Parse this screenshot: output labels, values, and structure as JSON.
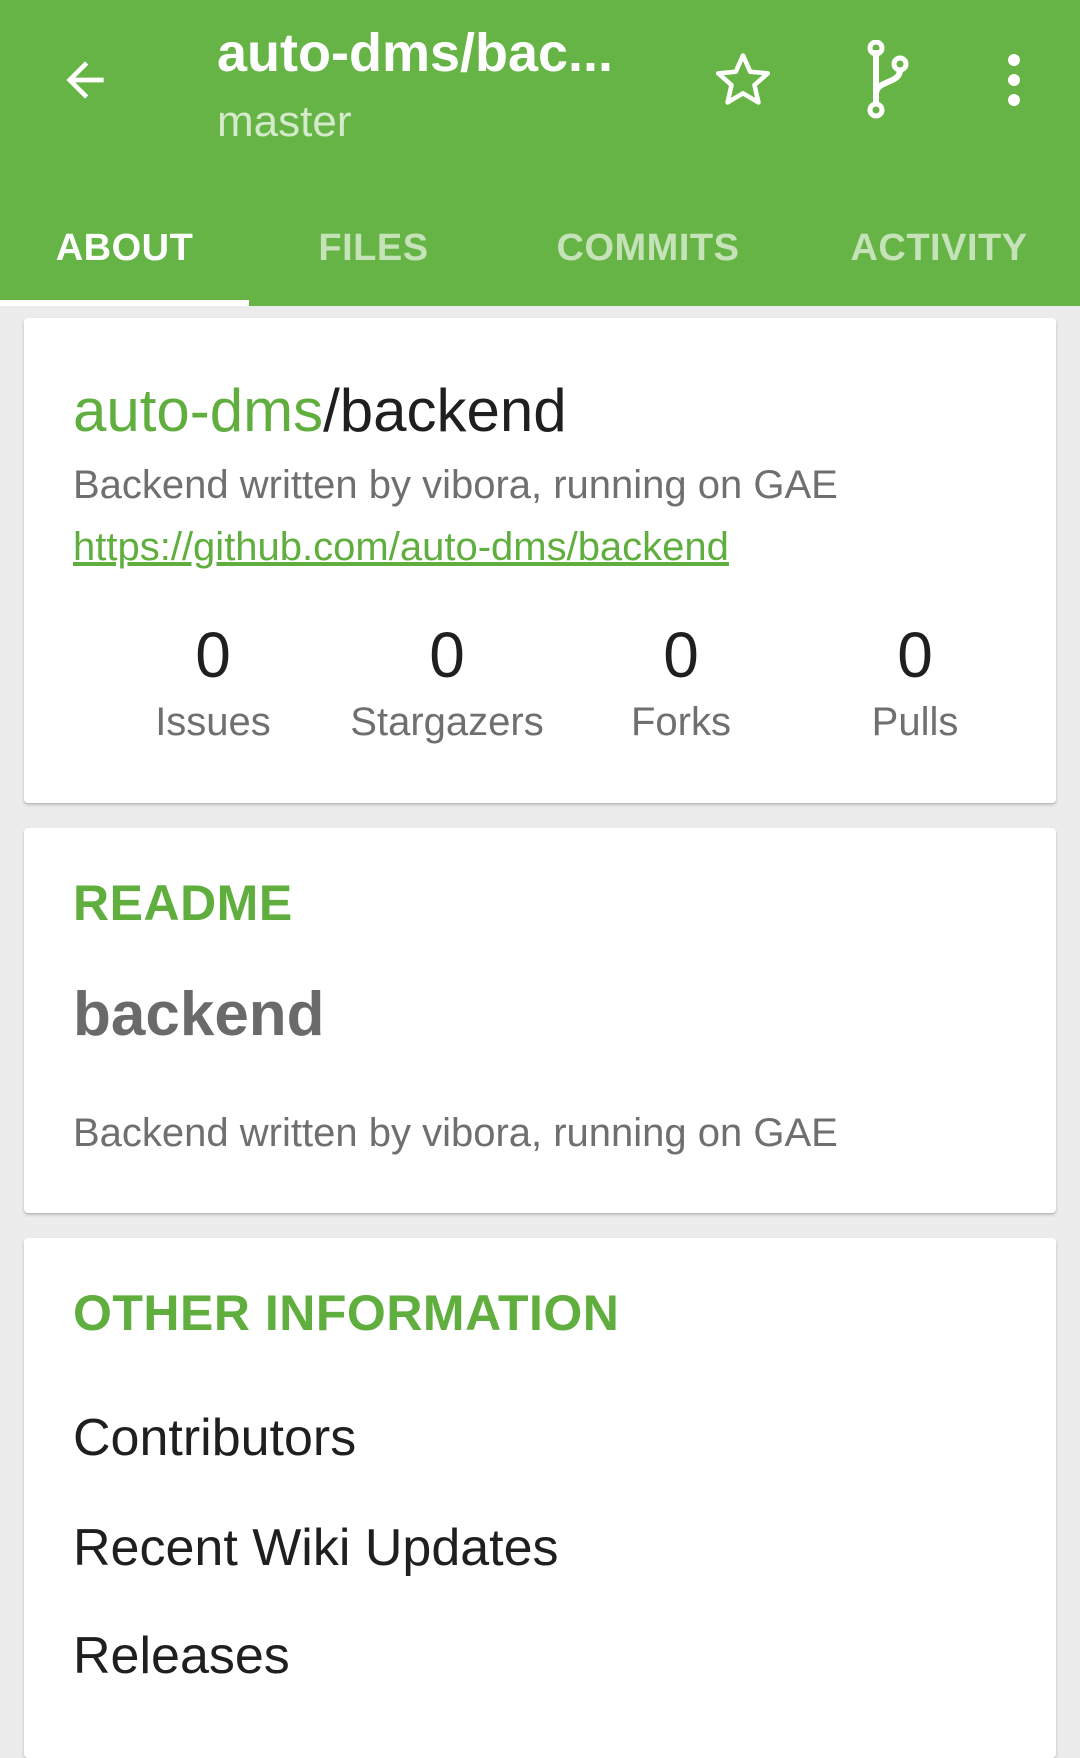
{
  "app_bar": {
    "title": "auto-dms/bac...",
    "subtitle": "master",
    "color": "#66b445"
  },
  "icons": {
    "back": "arrow-back-icon",
    "star": "star-outline-icon",
    "branch": "git-branch-icon",
    "more": "more-vert-icon"
  },
  "tabs": [
    {
      "label": "ABOUT",
      "active": true
    },
    {
      "label": "FILES",
      "active": false
    },
    {
      "label": "COMMITS",
      "active": false
    },
    {
      "label": "ACTIVITY",
      "active": false
    }
  ],
  "repo": {
    "owner": "auto-dms",
    "separator": "/",
    "name": "backend",
    "description": "Backend written by vibora, running on GAE",
    "url": "https://github.com/auto-dms/backend",
    "stats": [
      {
        "value": "0",
        "label": "Issues"
      },
      {
        "value": "0",
        "label": "Stargazers"
      },
      {
        "value": "0",
        "label": "Forks"
      },
      {
        "value": "0",
        "label": "Pulls"
      }
    ]
  },
  "readme": {
    "heading": "README",
    "title": "backend",
    "body": "Backend written by vibora, running on GAE"
  },
  "other_information": {
    "heading": "OTHER INFORMATION",
    "items": [
      "Contributors",
      "Recent Wiki Updates",
      "Releases"
    ]
  },
  "colors": {
    "accent": "#5fae3e",
    "primary": "#66b445",
    "background": "#ececec"
  }
}
